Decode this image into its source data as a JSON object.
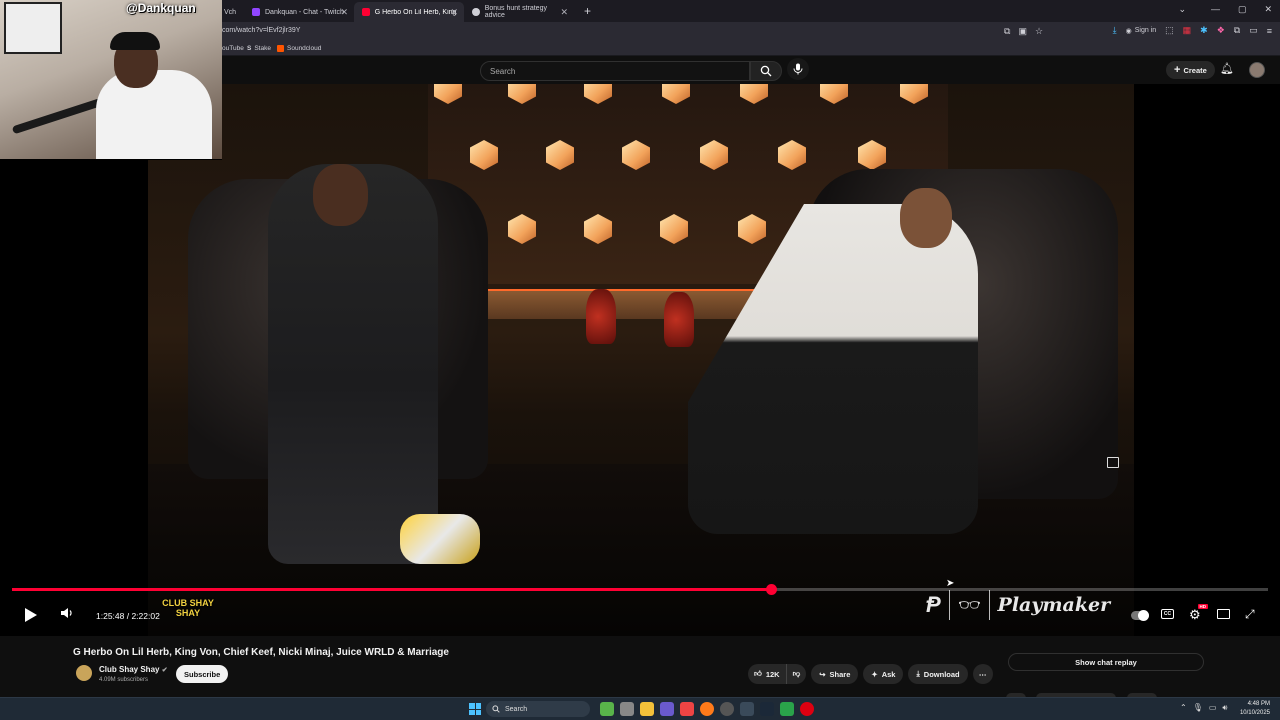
{
  "browser": {
    "tabs": [
      {
        "label": "Vch",
        "active": false,
        "color": "#9aa0a6"
      },
      {
        "label": "Dankquan - Chat - Twitch",
        "active": false,
        "color": "#9146ff"
      },
      {
        "label": "G Herbo On Lil Herb, King Von",
        "active": true,
        "color": "#ff0033"
      },
      {
        "label": "Bonus hunt strategy advice",
        "active": false,
        "color": "#cfcfd6"
      }
    ],
    "url": "com/watch?v=lEvf2jlr39Y",
    "signin_label": "Sign in",
    "bookmarks": [
      {
        "label": "ouTube",
        "color": "#ff0033"
      },
      {
        "label": "Stake",
        "color": "#cfcfd6"
      },
      {
        "label": "Soundcloud",
        "color": "#ff5500"
      }
    ]
  },
  "webcam": {
    "streamer_name": "@Dankquan"
  },
  "youtube": {
    "search_placeholder": "Search",
    "create_label": "Create"
  },
  "player": {
    "current_time": "1:25:48",
    "duration": "2:22:02",
    "time_display": "1:25:48 / 2:22:02",
    "progress_fraction": 0.604,
    "hd_badge": "HD",
    "cc_label": "CC",
    "channel_overlay_text": "CLUB SHAY SHAY",
    "sponsor_text": "Playmaker",
    "accent_color": "#ff0033"
  },
  "video": {
    "title": "G Herbo On Lil Herb, King Von, Chief Keef, Nicki Minaj, Juice WRLD & Marriage",
    "channel_name": "Club Shay Shay",
    "subscribers": "4.09M subscribers",
    "subscribe_label": "Subscribe",
    "likes": "12K",
    "share_label": "Share",
    "ask_label": "Ask",
    "download_label": "Download",
    "show_chat_replay_label": "Show chat replay"
  },
  "taskbar": {
    "search_label": "Search",
    "time": "4:48 PM",
    "date": "10/10/2025"
  }
}
